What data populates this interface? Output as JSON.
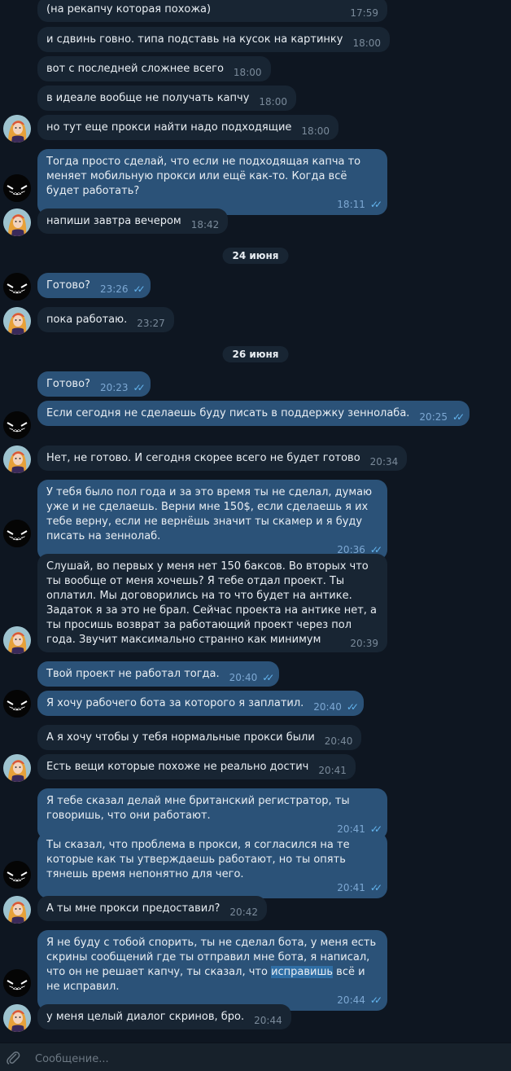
{
  "colors": {
    "background": "#0e1621",
    "incoming_bubble": "#182533",
    "outgoing_bubble": "#2b5278",
    "read_check": "#64b5ef",
    "composer_bg": "#17212b"
  },
  "dates": [
    "24 июня",
    "26 июня"
  ],
  "messages": [
    {
      "text": "(на рекапчу которая похожа)",
      "time": "17:59"
    },
    {
      "text": "и сдвинь говно. типа подставь на кусок на картинку",
      "time": "18:00"
    },
    {
      "text": "вот с последней сложнее всего",
      "time": "18:00"
    },
    {
      "text": "в идеале вообще не получать капчу",
      "time": "18:00"
    },
    {
      "text": "но тут еще прокси найти надо подходящие",
      "time": "18:00"
    },
    {
      "text": "Тогда просто сделай, что если не подходящая капча то меняет мобильную прокси или ещё как-то. Когда всё будет работать?",
      "time": "18:11"
    },
    {
      "text": "напиши завтра вечером",
      "time": "18:42"
    },
    {
      "text": "Готово?",
      "time": "23:26"
    },
    {
      "text": "пока работаю.",
      "time": "23:27"
    },
    {
      "text": "Готово?",
      "time": "20:23"
    },
    {
      "text": "Если сегодня не сделаешь буду писать в поддержку зеннолаба.",
      "time": "20:25"
    },
    {
      "text": "Нет, не готово. И сегодня скорее всего не будет готово",
      "time": "20:34"
    },
    {
      "text": "У тебя было пол года и за это время ты не сделал, думаю уже и не сделаешь. Верни мне 150$, если сделаешь я их тебе верну, если не вернёшь значит ты скамер и я буду писать на зеннолаб.",
      "time": "20:36"
    },
    {
      "text": "Слушай, во первых у меня нет 150 баксов. Во вторых что ты вообще от меня хочешь? Я тебе отдал проект. Ты оплатил. Мы договорились на то что будет на антике. Задаток я за это не брал. Сейчас проекта на антике нет, а ты просишь возврат за работающий проект через пол года. Звучит максимально странно как минимум",
      "time": "20:39"
    },
    {
      "text": "Твой проект не работал тогда.",
      "time": "20:40"
    },
    {
      "text": "Я хочу рабочего бота за которого я заплатил.",
      "time": "20:40"
    },
    {
      "text": "А я хочу чтобы у тебя нормальные прокси были",
      "time": "20:40"
    },
    {
      "text": "Есть вещи которые похоже не реально достич",
      "time": "20:41"
    },
    {
      "text": "Я тебе сказал делай мне британский регистратор, ты говоришь, что они работают.",
      "time": "20:41"
    },
    {
      "text": "Ты сказал, что проблема в прокси, я согласился на те которые как ты утверждаешь работают, но ты опять тянешь время непонятно для чего.",
      "time": "20:41"
    },
    {
      "text": "А ты мне прокси предоставил?",
      "time": "20:42"
    },
    {
      "text_before": "Я не буду с тобой спорить, ты не сделал бота, у меня есть скрины сообщений где ты отправил мне бота, я написал, что он не решает капчу, ты сказал, что ",
      "highlight": "исправишь",
      "text_after": " всё и не исправил.",
      "time": "20:44"
    },
    {
      "text": "у меня целый диалог скринов, бро.",
      "time": "20:44"
    }
  ],
  "composer": {
    "placeholder": "Сообщение..."
  }
}
